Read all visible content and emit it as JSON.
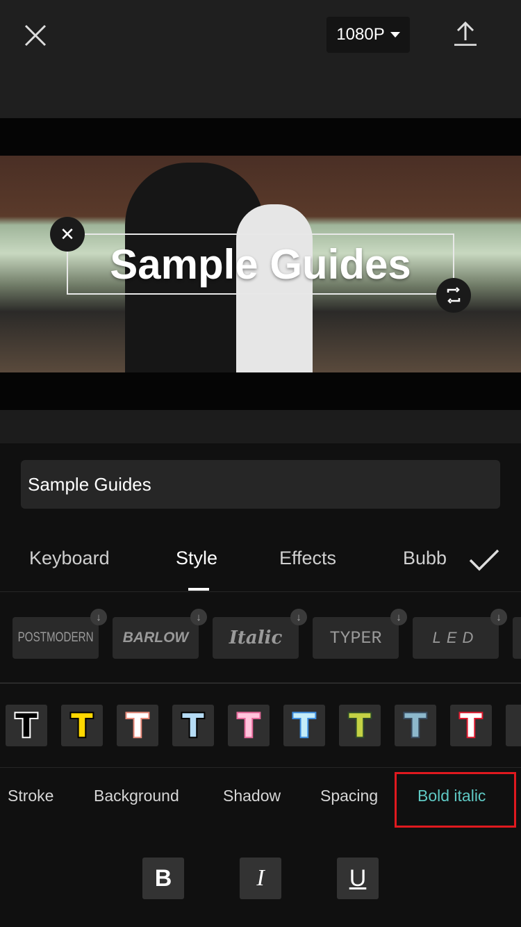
{
  "header": {
    "resolution": "1080P",
    "close_icon": "close-icon",
    "export_icon": "upload-icon"
  },
  "canvas": {
    "overlay_text": "Sample Guides"
  },
  "text_input": {
    "value": "Sample Guides"
  },
  "tabs": [
    {
      "label": "Keyboard"
    },
    {
      "label": "Style",
      "active": true
    },
    {
      "label": "Effects"
    },
    {
      "label": "Bubb"
    }
  ],
  "fonts": [
    {
      "label": "POSTMODERN"
    },
    {
      "label": "BARLOW"
    },
    {
      "label": "Italic"
    },
    {
      "label": "TYPER"
    },
    {
      "label": "LED"
    }
  ],
  "presets": [
    {
      "glyph": "T",
      "fill": "#000000",
      "stroke": "#ffffff"
    },
    {
      "glyph": "T",
      "fill": "#ffd800",
      "stroke": "#000000"
    },
    {
      "glyph": "T",
      "fill": "#ffffff",
      "stroke": "#e88a7a"
    },
    {
      "glyph": "T",
      "fill": "#b6dcf5",
      "stroke": "#000000"
    },
    {
      "glyph": "T",
      "fill": "#ffc4dc",
      "stroke": "#e76a9c"
    },
    {
      "glyph": "T",
      "fill": "#c4ecf8",
      "stroke": "#3d8ee0"
    },
    {
      "glyph": "T",
      "fill": "#c4d244",
      "stroke": "#2e4a2a"
    },
    {
      "glyph": "T",
      "fill": "#8db8cc",
      "stroke": "#3a4e62"
    },
    {
      "glyph": "T",
      "fill": "#ffffff",
      "stroke": "#e0192e"
    }
  ],
  "style_options": [
    {
      "label": "Stroke"
    },
    {
      "label": "Background"
    },
    {
      "label": "Shadow"
    },
    {
      "label": "Spacing"
    },
    {
      "label": "Bold italic",
      "active": true
    }
  ],
  "format_buttons": [
    {
      "label": "B"
    },
    {
      "label": "I"
    },
    {
      "label": "U"
    }
  ],
  "colors": {
    "accent": "#5fc9c4",
    "highlight": "#e0191f"
  }
}
